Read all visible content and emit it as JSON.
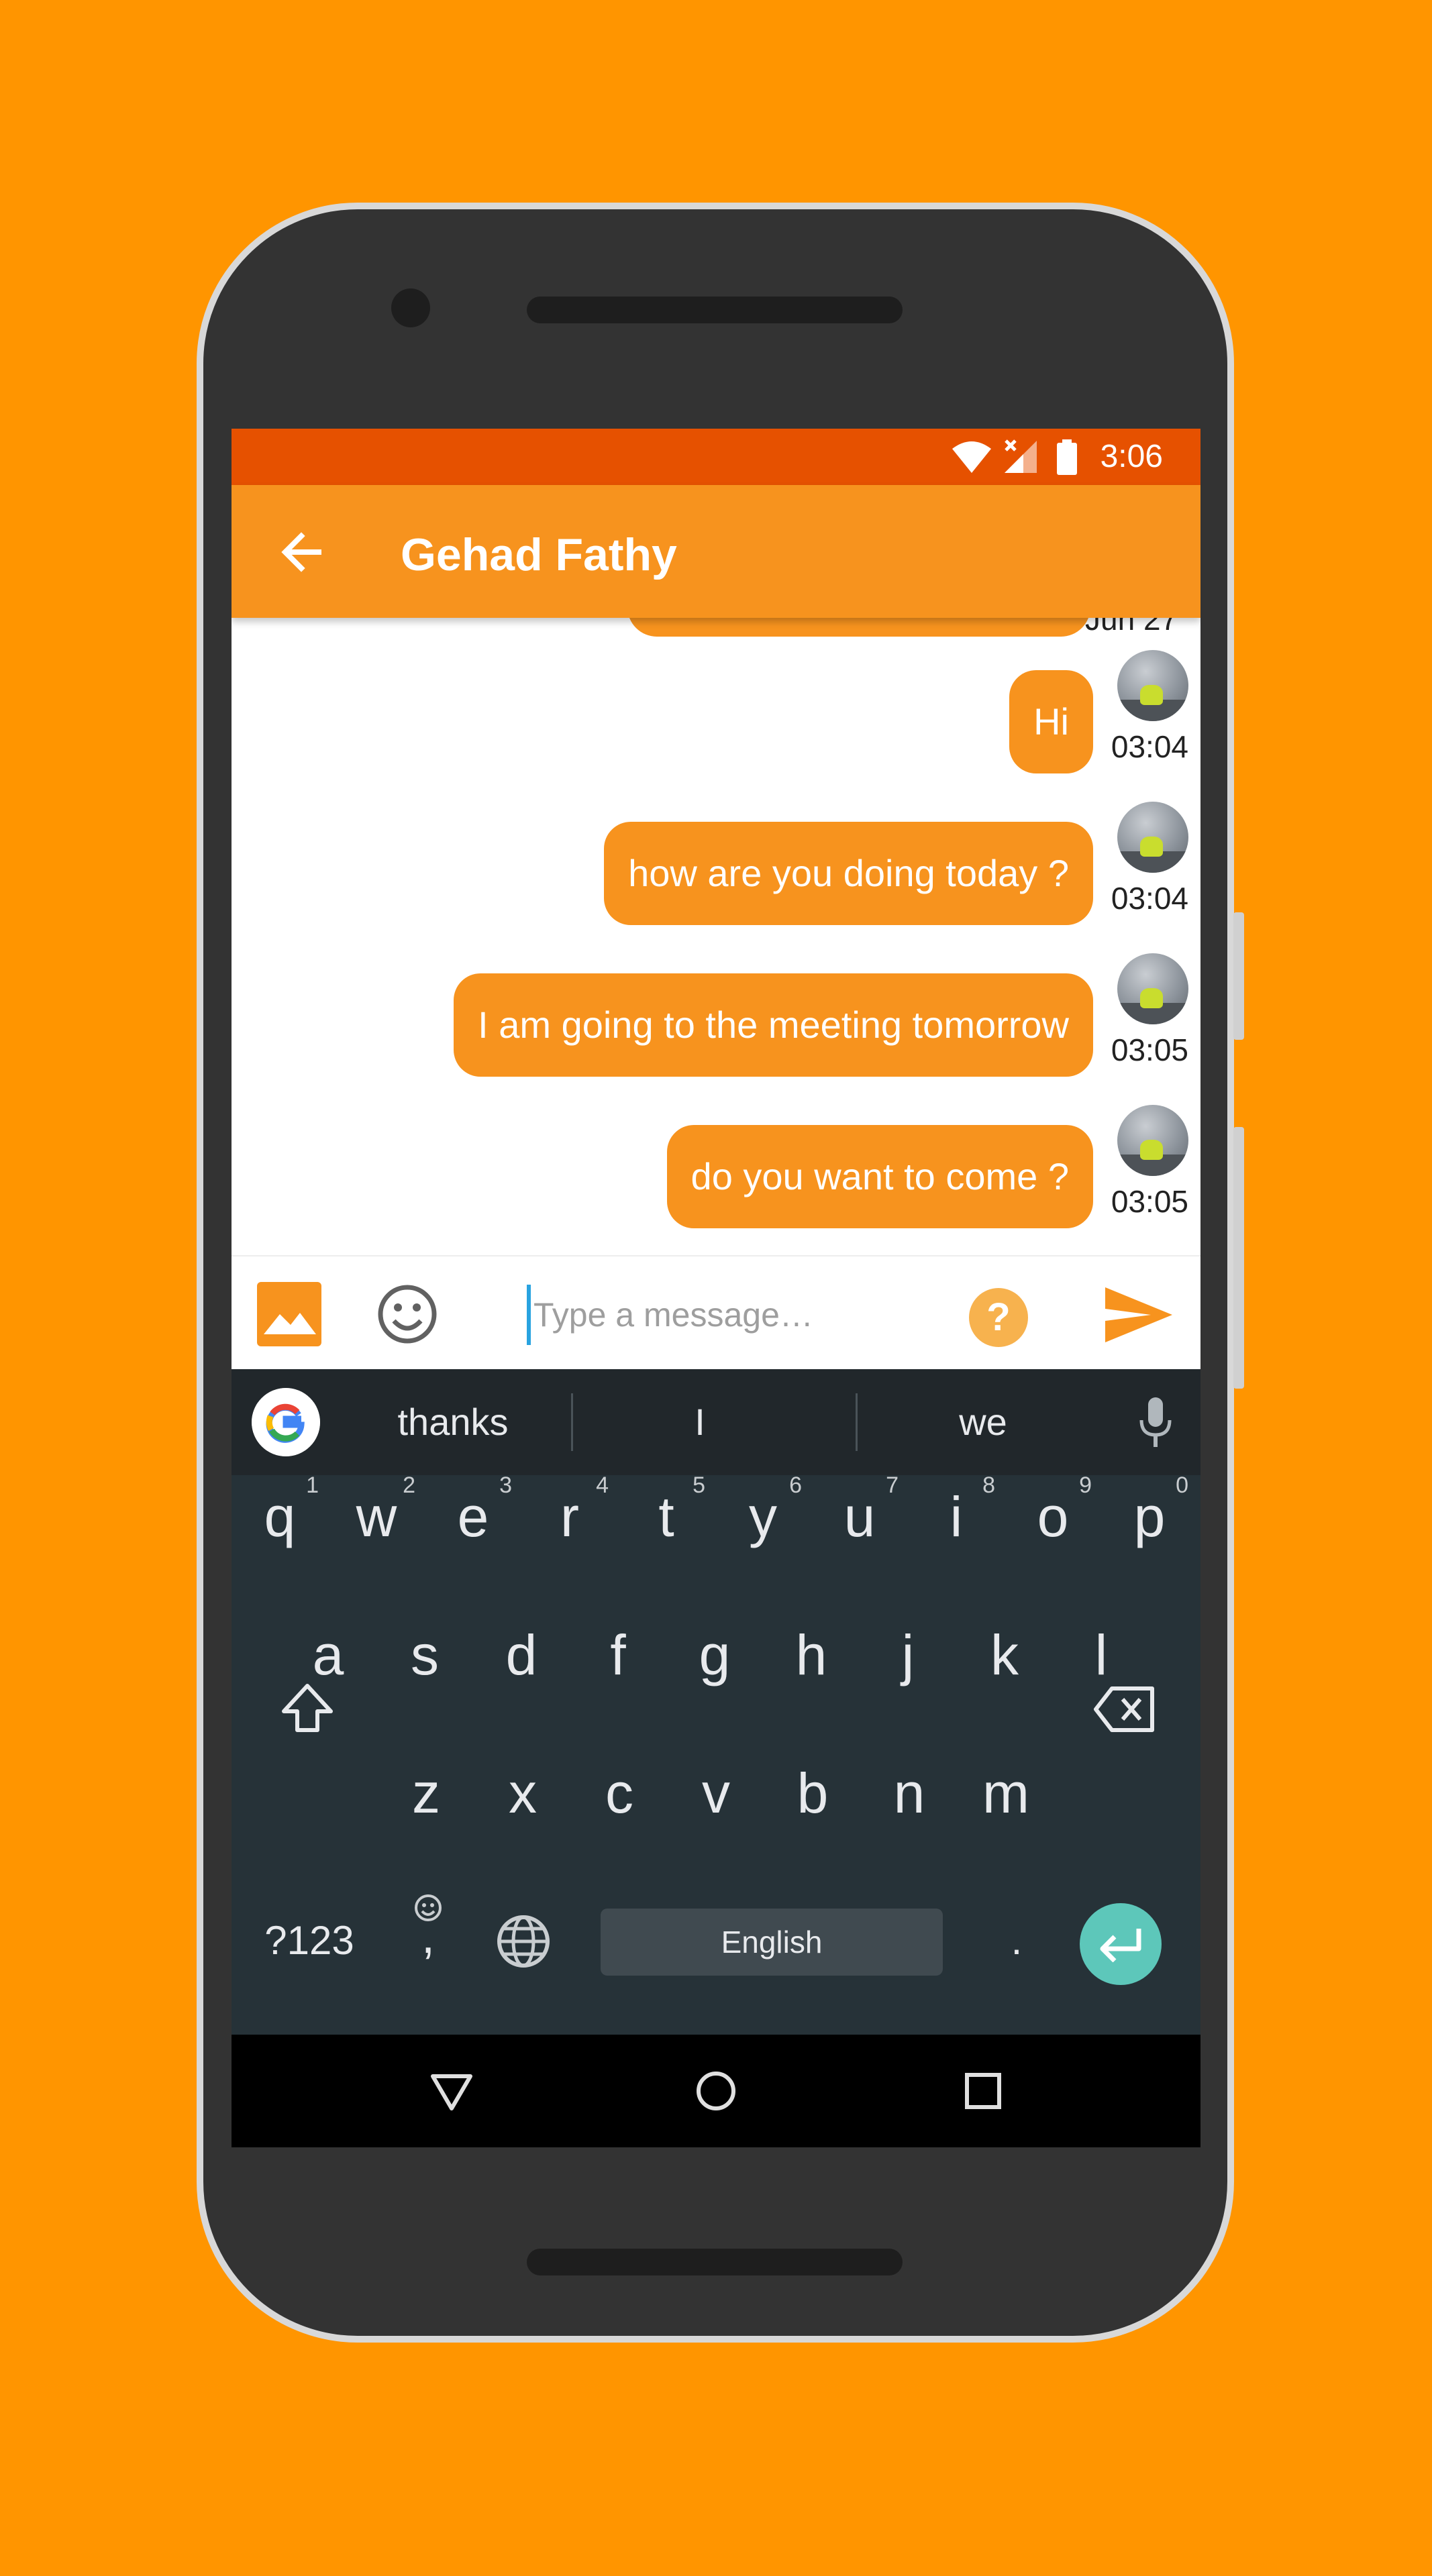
{
  "status_bar": {
    "time": "3:06"
  },
  "app_bar": {
    "title": "Gehad Fathy"
  },
  "messages": {
    "partial_time": "Jun 27",
    "items": [
      {
        "text": "Hi",
        "time": "03:04"
      },
      {
        "text": "how are you doing today ?",
        "time": "03:04"
      },
      {
        "text": "I am going to the meeting tomorrow",
        "time": "03:05"
      },
      {
        "text": "do you want to come ?",
        "time": "03:05"
      }
    ]
  },
  "input": {
    "placeholder": "Type a message…"
  },
  "keyboard": {
    "suggestions": [
      "thanks",
      "I",
      "we"
    ],
    "row1": [
      {
        "k": "q",
        "h": "1"
      },
      {
        "k": "w",
        "h": "2"
      },
      {
        "k": "e",
        "h": "3"
      },
      {
        "k": "r",
        "h": "4"
      },
      {
        "k": "t",
        "h": "5"
      },
      {
        "k": "y",
        "h": "6"
      },
      {
        "k": "u",
        "h": "7"
      },
      {
        "k": "i",
        "h": "8"
      },
      {
        "k": "o",
        "h": "9"
      },
      {
        "k": "p",
        "h": "0"
      }
    ],
    "row2": [
      "a",
      "s",
      "d",
      "f",
      "g",
      "h",
      "j",
      "k",
      "l"
    ],
    "row3": [
      "z",
      "x",
      "c",
      "v",
      "b",
      "n",
      "m"
    ],
    "symbols_label": "?123",
    "comma_label": ",",
    "space_label": "English",
    "period_label": "."
  },
  "colors": {
    "background": "#FF9500",
    "status_bar": "#E65100",
    "app_bar": "#F7931E",
    "bubble": "#F7931E",
    "keyboard": "#263238",
    "enter_key": "#5DC7BA"
  },
  "icons": {
    "back": "arrow-left-icon",
    "gallery": "image-icon",
    "emoji": "smiley-icon",
    "help": "question-icon",
    "send": "send-icon",
    "mic": "mic-icon",
    "shift": "shift-icon",
    "backspace": "backspace-icon",
    "globe": "globe-icon",
    "enter": "enter-icon"
  }
}
